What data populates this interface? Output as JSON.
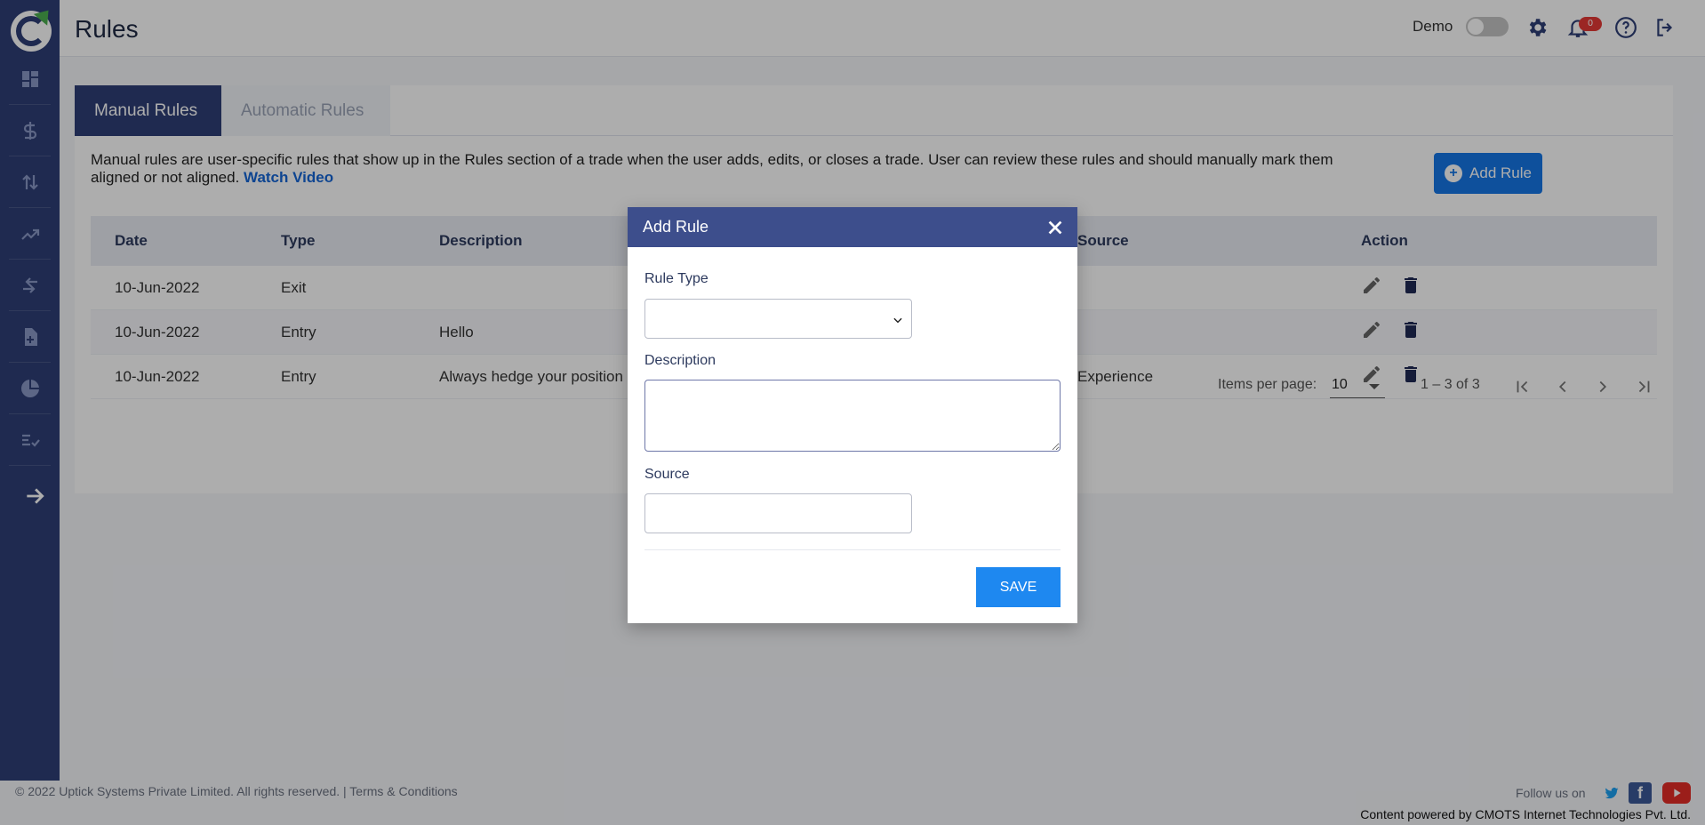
{
  "header": {
    "title": "Rules",
    "demo_label": "Demo",
    "notification_count": "0"
  },
  "sidebar": {
    "items": [
      {
        "name": "dashboard"
      },
      {
        "name": "dollar"
      },
      {
        "name": "trades"
      },
      {
        "name": "analytics"
      },
      {
        "name": "transfer"
      },
      {
        "name": "add-document"
      },
      {
        "name": "pie-chart"
      },
      {
        "name": "rules-checklist"
      }
    ]
  },
  "tabs": [
    {
      "label": "Manual Rules",
      "active": true
    },
    {
      "label": "Automatic Rules",
      "active": false
    }
  ],
  "intro": {
    "text": "Manual rules are user-specific rules that show up in the Rules section of a trade when the user adds, edits, or closes a trade. User can review these rules and should manually mark them aligned or not aligned. ",
    "link_text": "Watch Video"
  },
  "add_button_label": "Add Rule",
  "table": {
    "columns": {
      "date": "Date",
      "type": "Type",
      "description": "Description",
      "source": "Source",
      "action": "Action"
    },
    "rows": [
      {
        "date": "10-Jun-2022",
        "type": "Exit",
        "description": "",
        "source": ""
      },
      {
        "date": "10-Jun-2022",
        "type": "Entry",
        "description": "Hello",
        "source": ""
      },
      {
        "date": "10-Jun-2022",
        "type": "Entry",
        "description": "Always hedge your position",
        "source": "Experience"
      }
    ]
  },
  "pagination": {
    "items_per_page_label": "Items per page:",
    "items_per_page_value": "10",
    "range": "1 – 3 of 3"
  },
  "modal": {
    "title": "Add Rule",
    "rule_type_label": "Rule Type",
    "rule_type_value": "",
    "description_label": "Description",
    "description_value": "",
    "source_label": "Source",
    "source_value": "",
    "save_label": "SAVE"
  },
  "footer": {
    "copyright": "© 2022 Uptick Systems Private Limited. All rights reserved. | Terms & Conditions",
    "follow_us": "Follow us on",
    "powered_by": "Content powered by CMOTS Internet Technologies Pvt. Ltd."
  },
  "colors": {
    "sidebar": "#2e3f76",
    "modal_header": "#3d4e8c",
    "primary_button": "#1677e6",
    "save_button": "#1e88f0",
    "badge": "#e53935"
  }
}
